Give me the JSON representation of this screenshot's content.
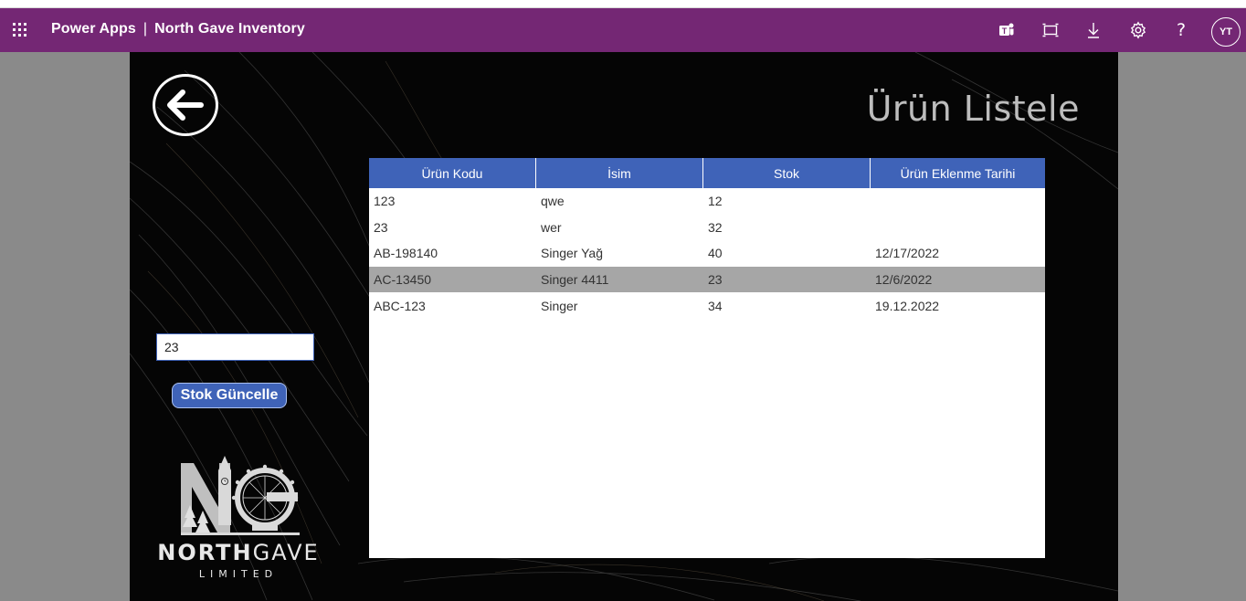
{
  "app": {
    "product": "Power Apps",
    "separator": "|",
    "name": "North Gave Inventory",
    "user_initials": "YT",
    "header_color": "#742774"
  },
  "topbar_icons": [
    "teams-icon",
    "fit-to-window-icon",
    "download-icon",
    "settings-gear-icon",
    "help-icon"
  ],
  "help_glyph": "?",
  "page": {
    "title": "Ürün Listele"
  },
  "table": {
    "columns": [
      "Ürün Kodu",
      "İsim",
      "Stok",
      "Ürün Eklenme Tarihi"
    ],
    "rows": [
      [
        "123",
        "qwe",
        "12",
        ""
      ],
      [
        "23",
        "wer",
        "32",
        ""
      ],
      [
        "AB-198140",
        "Singer Yağ",
        "40",
        "12/17/2022"
      ],
      [
        "AC-13450",
        "Singer 4411",
        "23",
        "12/6/2022"
      ],
      [
        "ABC-123",
        "Singer",
        "34",
        "19.12.2022"
      ]
    ],
    "selected_row": 3,
    "header_color": "#3f63b8"
  },
  "stock_form": {
    "input_value": "23",
    "button_label": "Stok Güncelle",
    "button_color": "#3f63b8"
  },
  "logo": {
    "name_bold": "NORTH",
    "name_light": "GAVE",
    "subtitle": "LIMITED"
  }
}
